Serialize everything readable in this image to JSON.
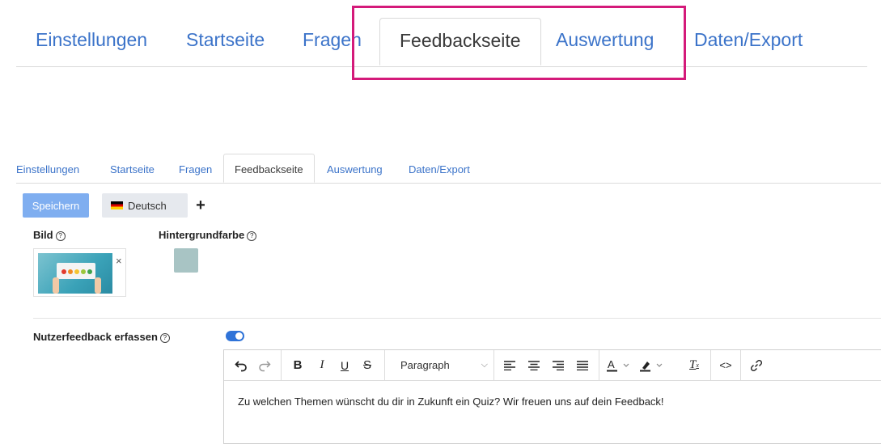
{
  "big_tabs": [
    {
      "label": "Einstellungen"
    },
    {
      "label": "Startseite"
    },
    {
      "label": "Fragen"
    },
    {
      "label": "Feedbackseite",
      "active": true
    },
    {
      "label": "Auswertung"
    },
    {
      "label": "Daten/Export"
    }
  ],
  "small_tabs": [
    {
      "label": "Einstellungen"
    },
    {
      "label": "Startseite"
    },
    {
      "label": "Fragen"
    },
    {
      "label": "Feedbackseite",
      "active": true
    },
    {
      "label": "Auswertung"
    },
    {
      "label": "Daten/Export"
    }
  ],
  "toolbar": {
    "save_label": "Speichern",
    "language": "Deutsch",
    "add_label": "+"
  },
  "fields": {
    "image_label": "Bild",
    "bgcolor_label": "Hintergrundfarbe",
    "bgcolor_value": "#a8c4c4",
    "feedback_label": "Nutzerfeedback erfassen",
    "feedback_enabled": true,
    "help_glyph": "?",
    "remove_glyph": "×"
  },
  "editor": {
    "block_format": "Paragraph",
    "content": "Zu welchen Themen wünscht du dir in Zukunft ein Quiz? Wir freuen uns auf dein Feedback!",
    "tools": [
      "undo-icon",
      "redo-icon",
      "bold-icon",
      "italic-icon",
      "underline-icon",
      "strikethrough-icon",
      "align-left-icon",
      "align-center-icon",
      "align-right-icon",
      "align-justify-icon",
      "text-color-icon",
      "highlight-color-icon",
      "clear-formatting-icon",
      "code-icon",
      "link-icon"
    ]
  },
  "colors": {
    "accent": "#3b73c9",
    "highlight_box": "#d41a7a",
    "save_button": "#7faef0",
    "toggle_on": "#2f73d8"
  }
}
